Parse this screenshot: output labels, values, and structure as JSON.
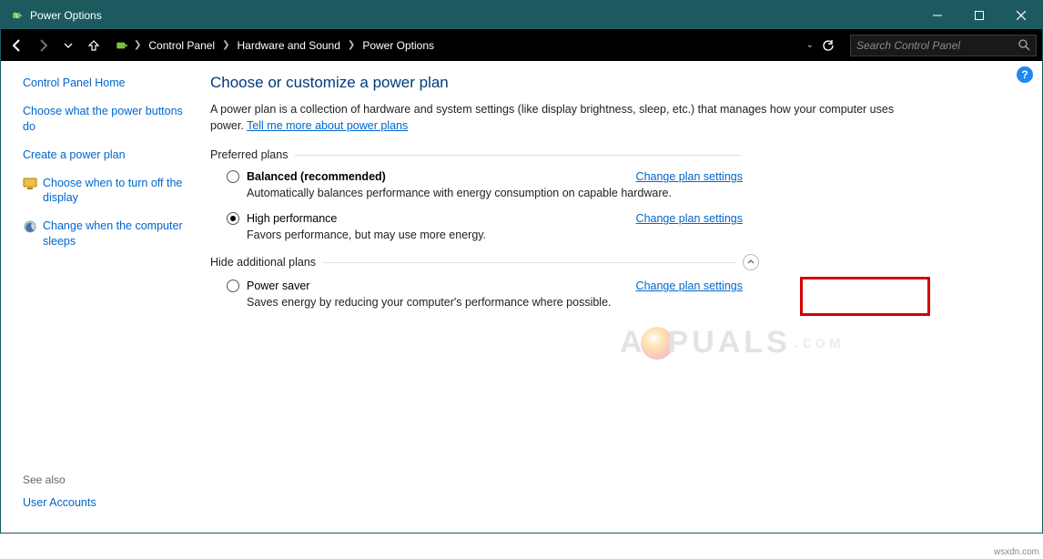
{
  "window": {
    "title": "Power Options"
  },
  "breadcrumb": {
    "root": "Control Panel",
    "mid": "Hardware and Sound",
    "leaf": "Power Options"
  },
  "search": {
    "placeholder": "Search Control Panel"
  },
  "sidebar": {
    "home": "Control Panel Home",
    "links": [
      "Choose what the power buttons do",
      "Create a power plan",
      "Choose when to turn off the display",
      "Change when the computer sleeps"
    ],
    "see_also_label": "See also",
    "see_also_link": "User Accounts"
  },
  "main": {
    "heading": "Choose or customize a power plan",
    "description_a": "A power plan is a collection of hardware and system settings (like display brightness, sleep, etc.) that manages how your computer uses power. ",
    "description_link": "Tell me more about power plans",
    "preferred_label": "Preferred plans",
    "hide_label": "Hide additional plans",
    "change_link": "Change plan settings",
    "plans": {
      "balanced": {
        "name": "Balanced (recommended)",
        "desc": "Automatically balances performance with energy consumption on capable hardware."
      },
      "high": {
        "name": "High performance",
        "desc": "Favors performance, but may use more energy."
      },
      "saver": {
        "name": "Power saver",
        "desc": "Saves energy by reducing your computer's performance where possible."
      }
    }
  },
  "help_badge": "?",
  "attribution": "wsxdn.com"
}
